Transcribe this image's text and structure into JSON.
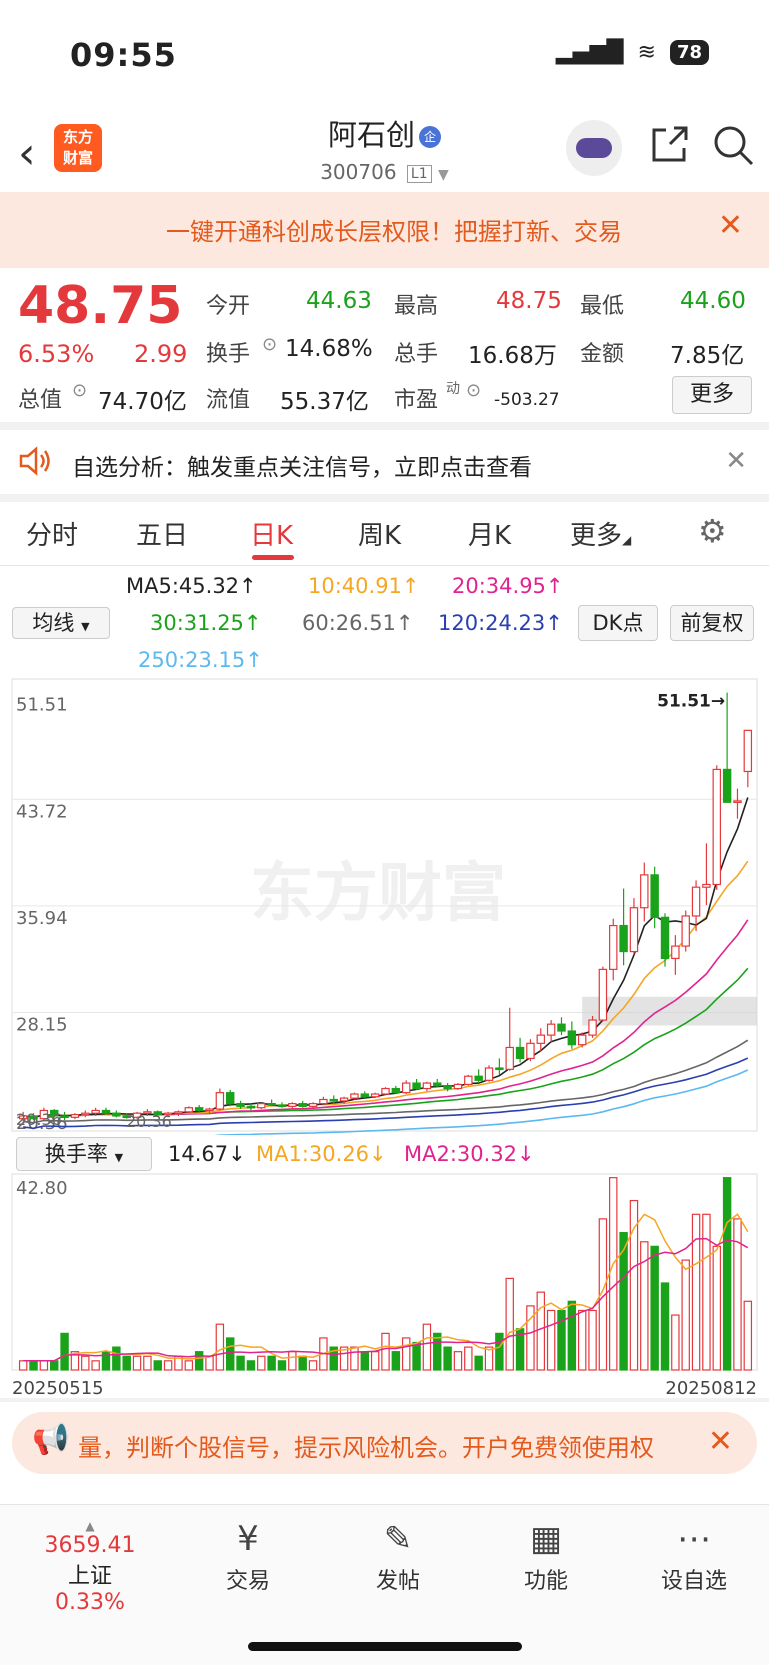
{
  "status": {
    "time": "09:55",
    "battery": "78"
  },
  "header": {
    "title": "阿石创",
    "badge": "企",
    "code": "300706",
    "level": "L1",
    "logo_line1": "东方",
    "logo_line2": "财富"
  },
  "banner": {
    "text": "一键开通科创成长层权限！把握打新、交易",
    "close": "✕"
  },
  "quote": {
    "price": "48.75",
    "change_pct": "6.53%",
    "change_amt": "2.99",
    "open_label": "今开",
    "open": "44.63",
    "high_label": "最高",
    "high": "48.75",
    "low_label": "最低",
    "low": "44.60",
    "turnover_label": "换手",
    "turnover": "14.68%",
    "volume_label": "总手",
    "volume": "16.68万",
    "amount_label": "金额",
    "amount": "7.85亿",
    "mktcap_label": "总值",
    "mktcap": "74.70亿",
    "float_label": "流值",
    "float_cap": "55.37亿",
    "pe_label": "市盈",
    "pe_sup": "动",
    "pe": "-503.27",
    "more": "更多"
  },
  "alert": {
    "text": "自选分析：触发重点关注信号，立即点击查看",
    "close": "✕"
  },
  "tabs": [
    {
      "label": "分时"
    },
    {
      "label": "五日"
    },
    {
      "label": "日K"
    },
    {
      "label": "周K"
    },
    {
      "label": "月K"
    },
    {
      "label": "更多"
    }
  ],
  "ma_legend": {
    "select": "均线",
    "ma5": "MA5:45.32↑",
    "ma10": "10:40.91↑",
    "ma20": "20:34.95↑",
    "ma30": "30:31.25↑",
    "ma60": "60:26.51↑",
    "ma120": "120:24.23↑",
    "ma250": "250:23.15↑",
    "dk": "DK点",
    "fq": "前复权",
    "colors": {
      "ma5": "#222222",
      "ma10": "#f5a623",
      "ma20": "#e0238f",
      "ma30": "#1aa31a",
      "ma60": "#666666",
      "ma120": "#2a3fb0",
      "ma250": "#5bb8f0"
    }
  },
  "chart_data": {
    "type": "candlestick",
    "y_ticks": [
      "51.51",
      "43.72",
      "35.94",
      "28.15",
      "20.36"
    ],
    "ylim": [
      19.5,
      52.5
    ],
    "max_label": "51.51→",
    "min_label_left": "20.36",
    "min_label_right": "20.36",
    "watermark": "东方财富",
    "candles": [
      [
        20.4,
        20.9,
        20.2,
        20.6
      ],
      [
        20.6,
        20.8,
        20.3,
        20.4
      ],
      [
        20.4,
        21.2,
        20.3,
        21.0
      ],
      [
        21.0,
        21.1,
        20.5,
        20.6
      ],
      [
        20.6,
        20.9,
        20.3,
        20.5
      ],
      [
        20.5,
        20.8,
        20.36,
        20.7
      ],
      [
        20.7,
        21.0,
        20.5,
        20.8
      ],
      [
        20.8,
        21.2,
        20.6,
        21.0
      ],
      [
        21.0,
        21.2,
        20.7,
        20.8
      ],
      [
        20.8,
        21.0,
        20.5,
        20.6
      ],
      [
        20.6,
        20.8,
        20.4,
        20.5
      ],
      [
        20.5,
        20.9,
        20.4,
        20.8
      ],
      [
        20.8,
        21.1,
        20.6,
        20.9
      ],
      [
        20.9,
        21.0,
        20.6,
        20.7
      ],
      [
        20.7,
        20.9,
        20.5,
        20.8
      ],
      [
        20.8,
        21.0,
        20.6,
        20.9
      ],
      [
        20.9,
        21.3,
        20.8,
        21.2
      ],
      [
        21.2,
        21.4,
        20.9,
        21.0
      ],
      [
        21.0,
        21.2,
        20.8,
        21.1
      ],
      [
        21.1,
        22.6,
        21.0,
        22.3
      ],
      [
        22.3,
        22.5,
        21.3,
        21.5
      ],
      [
        21.5,
        21.7,
        21.1,
        21.3
      ],
      [
        21.3,
        21.5,
        21.0,
        21.2
      ],
      [
        21.2,
        21.6,
        21.1,
        21.5
      ],
      [
        21.5,
        21.8,
        21.3,
        21.4
      ],
      [
        21.4,
        21.6,
        21.2,
        21.3
      ],
      [
        21.3,
        21.6,
        21.1,
        21.5
      ],
      [
        21.5,
        21.7,
        21.2,
        21.3
      ],
      [
        21.3,
        21.6,
        21.2,
        21.5
      ],
      [
        21.5,
        22.0,
        21.4,
        21.8
      ],
      [
        21.8,
        22.1,
        21.5,
        21.7
      ],
      [
        21.7,
        22.0,
        21.5,
        21.9
      ],
      [
        21.9,
        22.3,
        21.8,
        22.2
      ],
      [
        22.2,
        22.4,
        21.9,
        22.0
      ],
      [
        22.0,
        22.3,
        21.9,
        22.2
      ],
      [
        22.2,
        22.7,
        22.1,
        22.6
      ],
      [
        22.6,
        22.8,
        22.2,
        22.3
      ],
      [
        22.3,
        23.2,
        22.2,
        23.0
      ],
      [
        23.0,
        23.3,
        22.5,
        22.6
      ],
      [
        22.6,
        23.1,
        22.4,
        23.0
      ],
      [
        23.0,
        23.3,
        22.7,
        22.8
      ],
      [
        22.8,
        23.0,
        22.4,
        22.6
      ],
      [
        22.6,
        23.0,
        22.5,
        22.9
      ],
      [
        22.9,
        23.6,
        22.8,
        23.5
      ],
      [
        23.5,
        24.0,
        23.0,
        23.2
      ],
      [
        23.2,
        24.3,
        23.1,
        24.1
      ],
      [
        24.1,
        24.8,
        23.6,
        24.0
      ],
      [
        24.0,
        28.5,
        23.9,
        25.6
      ],
      [
        25.6,
        26.3,
        24.5,
        24.8
      ],
      [
        24.8,
        26.2,
        24.6,
        25.9
      ],
      [
        25.9,
        27.0,
        25.3,
        26.5
      ],
      [
        26.5,
        27.6,
        26.0,
        27.3
      ],
      [
        27.3,
        27.8,
        26.5,
        26.8
      ],
      [
        26.8,
        27.5,
        25.5,
        25.8
      ],
      [
        25.8,
        26.7,
        25.6,
        26.5
      ],
      [
        26.5,
        27.9,
        26.3,
        27.6
      ],
      [
        27.6,
        31.5,
        27.5,
        31.3
      ],
      [
        31.3,
        35.0,
        30.5,
        34.5
      ],
      [
        34.5,
        37.2,
        31.6,
        32.6
      ],
      [
        32.6,
        36.5,
        32.4,
        35.8
      ],
      [
        35.8,
        39.1,
        34.8,
        38.2
      ],
      [
        38.2,
        38.8,
        34.3,
        35.1
      ],
      [
        35.1,
        35.4,
        31.5,
        32.1
      ],
      [
        32.1,
        33.8,
        30.9,
        33.0
      ],
      [
        33.0,
        35.6,
        32.6,
        35.2
      ],
      [
        35.2,
        37.8,
        34.1,
        37.3
      ],
      [
        37.3,
        40.5,
        36.0,
        37.5
      ],
      [
        37.5,
        46.2,
        37.1,
        45.9
      ],
      [
        45.9,
        51.51,
        45.2,
        43.5
      ],
      [
        43.5,
        44.5,
        42.3,
        43.6
      ],
      [
        45.75,
        48.75,
        44.6,
        48.75
      ]
    ]
  },
  "volume_legend": {
    "select": "换手率",
    "value": "14.67↓",
    "ma1": "MA1:30.26↓",
    "ma2": "MA2:30.32↓"
  },
  "volume_data": {
    "y_max_label": "42.80",
    "ylim": [
      0,
      42.8
    ],
    "start_date": "20250515",
    "end_date": "20250812",
    "values": [
      2,
      2,
      2,
      2,
      8,
      4,
      3,
      2,
      4,
      5,
      3,
      3,
      3,
      2,
      2,
      3,
      2,
      4,
      3,
      10,
      7,
      3,
      2,
      3,
      3,
      2,
      4,
      3,
      2,
      7,
      5,
      5,
      5,
      4,
      4,
      8,
      4,
      7,
      6,
      10,
      8,
      5,
      4,
      5,
      3,
      5,
      8,
      20,
      9,
      14,
      17,
      13,
      13,
      15,
      13,
      13,
      33,
      42,
      30,
      37,
      28,
      27,
      19,
      12,
      24,
      34,
      34,
      27,
      42,
      33,
      15
    ]
  },
  "promo2": {
    "text": "量，判断个股信号，提示风险机会。开户免费领使用权",
    "close": "✕"
  },
  "nav": {
    "index_value": "3659.41",
    "index_name": "上证",
    "index_change": "0.33%",
    "items": [
      {
        "label": "交易",
        "icon": "¥"
      },
      {
        "label": "发帖",
        "icon": "✎"
      },
      {
        "label": "功能",
        "icon": "▦"
      },
      {
        "label": "设自选",
        "icon": "⋯"
      }
    ]
  }
}
